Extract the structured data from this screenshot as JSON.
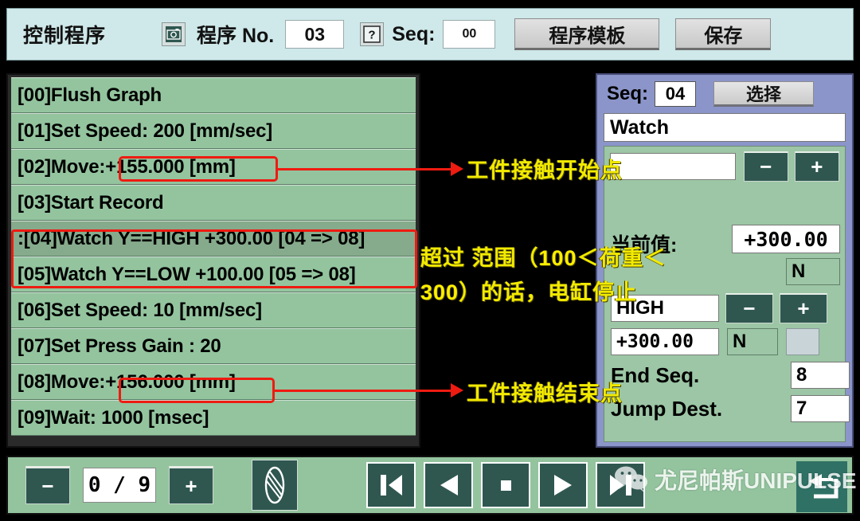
{
  "header": {
    "title": "控制程序",
    "camera_icon": "camera-icon",
    "program_no_label": "程序 No.",
    "program_no_value": "03",
    "help_icon": "question-mark-icon",
    "seq_label": "Seq:",
    "seq_value": "00",
    "template_button": "程序模板",
    "save_button": "保存"
  },
  "program_list": {
    "rows": [
      {
        "marker": "* ",
        "text": "[00]Flush Graph",
        "selected": false
      },
      {
        "marker": "",
        "text": "[01]Set Speed: 200 [mm/sec]",
        "selected": false
      },
      {
        "marker": "",
        "text": "[02]Move:+155.000 [mm]",
        "selected": false
      },
      {
        "marker": "",
        "text": "[03]Start Record",
        "selected": false
      },
      {
        "marker": "",
        "text": ":[04]Watch Y==HIGH +300.00 [04 => 08]",
        "selected": true
      },
      {
        "marker": "",
        "text": "[05]Watch Y==LOW +100.00 [05 => 08]",
        "selected": false
      },
      {
        "marker": "",
        "text": "[06]Set Speed: 10 [mm/sec]",
        "selected": false
      },
      {
        "marker": "",
        "text": "[07]Set Press Gain : 20",
        "selected": false
      },
      {
        "marker": "",
        "text": "[08]Move:+156.000 [mm]",
        "selected": false
      },
      {
        "marker": "",
        "text": "[09]Wait: 1000 [msec]",
        "selected": false
      }
    ]
  },
  "right_panel": {
    "seq_label": "Seq:",
    "seq_value": "04",
    "select_button": "选择",
    "command": "Watch",
    "argument_value": "",
    "minus_button": "−",
    "plus_button": "+",
    "current_label": "当前值:",
    "current_value": "+300.00",
    "current_unit": "N",
    "condition_value": "HIGH",
    "cond_minus_button": "−",
    "cond_plus_button": "+",
    "threshold_value": "+300.00",
    "threshold_unit": "N",
    "end_seq_label": "End Seq.",
    "end_seq_value": "8",
    "jump_dest_label": "Jump Dest.",
    "jump_dest_value": "7"
  },
  "bottom_bar": {
    "minus_button": "−",
    "page_counter": "0 / 9",
    "plus_button": "+",
    "graph_icon": "graph-leaf-icon",
    "first_icon": "skip-to-start-icon",
    "prev_icon": "play-reverse-icon",
    "stop_icon": "stop-icon",
    "next_icon": "play-forward-icon",
    "last_icon": "skip-to-end-icon",
    "back_icon": "return-arrow-icon"
  },
  "annotations": {
    "contact_start": "工件接触开始点",
    "range_line1_pre": "超过 范围（",
    "range_line1_num": "100",
    "range_line1_mid": "＜荷重＜",
    "range_line2_num": "300",
    "range_line2_post": "）的话，电缸停止",
    "contact_end": "工件接触结束点"
  },
  "watermark": {
    "icon": "wechat-icon",
    "text": "尤尼帕斯UNIPULSE"
  },
  "colors": {
    "header_bg": "#cfe8e9",
    "list_row": "#93c49e",
    "list_row_selected": "#86ab8c",
    "panel_purple": "#8b95c9",
    "panel_green": "#9cc6a5",
    "dark_button": "#2f5750",
    "annotation_yellow": "#f2ea00",
    "highlight_red": "#ee1b11"
  }
}
